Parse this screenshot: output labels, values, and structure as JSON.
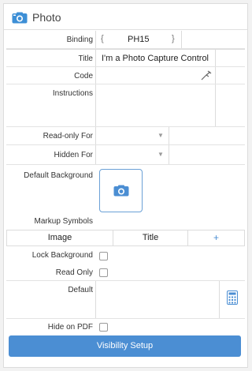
{
  "header": {
    "title": "Photo",
    "icon": "camera-icon",
    "icon_color": "#3d8fd6"
  },
  "fields": {
    "binding": {
      "label": "Binding",
      "brace_open": "{",
      "value": "PH15",
      "brace_close": "}"
    },
    "title": {
      "label": "Title",
      "value": "I'm a Photo Capture Control"
    },
    "code": {
      "label": "Code",
      "value": ""
    },
    "instructions": {
      "label": "Instructions",
      "value": ""
    },
    "readonly_for": {
      "label": "Read-only For",
      "value": ""
    },
    "hidden_for": {
      "label": "Hidden For",
      "value": ""
    },
    "default_background": {
      "label": "Default Background"
    },
    "markup_symbols": {
      "label": "Markup Symbols"
    },
    "markup_table": {
      "col_image": "Image",
      "col_title": "Title",
      "add": "+"
    },
    "lock_background": {
      "label": "Lock Background",
      "checked": false
    },
    "read_only": {
      "label": "Read Only",
      "checked": false
    },
    "default": {
      "label": "Default",
      "value": ""
    },
    "hide_on_pdf": {
      "label": "Hide on PDF",
      "checked": false
    }
  },
  "actions": {
    "visibility_setup": "Visibility Setup",
    "accent": "#4b8ed3"
  }
}
